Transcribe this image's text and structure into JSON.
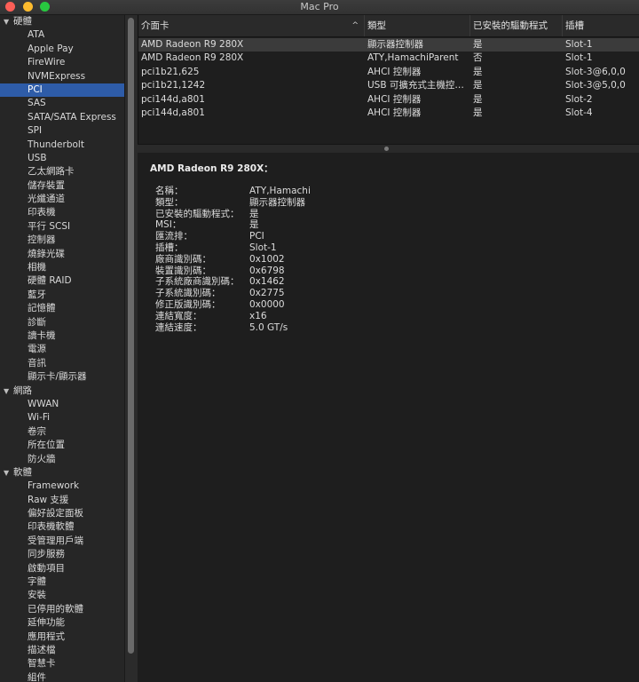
{
  "window": {
    "title": "Mac Pro",
    "traffic_lights": {
      "close": "#fe5f57",
      "minimize": "#febc2e",
      "zoom": "#28c840"
    }
  },
  "sidebar": {
    "groups": [
      {
        "label": "硬體",
        "expanded": true,
        "items": [
          "ATA",
          "Apple Pay",
          "FireWire",
          "NVMExpress",
          "PCI",
          "SAS",
          "SATA/SATA Express",
          "SPI",
          "Thunderbolt",
          "USB",
          "乙太網路卡",
          "儲存裝置",
          "光纖通道",
          "印表機",
          "平行 SCSI",
          "控制器",
          "燒錄光碟",
          "相機",
          "硬體 RAID",
          "藍牙",
          "記憶體",
          "診斷",
          "讀卡機",
          "電源",
          "音訊",
          "顯示卡/顯示器"
        ]
      },
      {
        "label": "網路",
        "expanded": true,
        "items": [
          "WWAN",
          "Wi-Fi",
          "卷宗",
          "所在位置",
          "防火牆"
        ]
      },
      {
        "label": "軟體",
        "expanded": true,
        "items": [
          "Framework",
          "Raw 支援",
          "偏好設定面板",
          "印表機軟體",
          "受管理用戶端",
          "同步服務",
          "啟動項目",
          "字體",
          "安裝",
          "已停用的軟體",
          "延伸功能",
          "應用程式",
          "描述檔",
          "智慧卡",
          "組件"
        ]
      }
    ],
    "selected": "PCI",
    "selection_color": "#2e5ca8"
  },
  "table": {
    "columns": [
      "介面卡",
      "類型",
      "已安裝的驅動程式",
      "插槽"
    ],
    "sort_icon": "chevron-up-icon",
    "rows": [
      {
        "card": "AMD Radeon R9 280X",
        "type": "顯示器控制器",
        "driver": "是",
        "slot": "Slot-1"
      },
      {
        "card": "AMD Radeon R9 280X",
        "type": "ATY,HamachiParent",
        "driver": "否",
        "slot": "Slot-1"
      },
      {
        "card": "pci1b21,625",
        "type": "AHCI 控制器",
        "driver": "是",
        "slot": "Slot-3@6,0,0"
      },
      {
        "card": "pci1b21,1242",
        "type": "USB 可擴充式主機控…",
        "driver": "是",
        "slot": "Slot-3@5,0,0"
      },
      {
        "card": "pci144d,a801",
        "type": "AHCI 控制器",
        "driver": "是",
        "slot": "Slot-2"
      },
      {
        "card": "pci144d,a801",
        "type": "AHCI 控制器",
        "driver": "是",
        "slot": "Slot-4"
      }
    ],
    "selected_row": 0
  },
  "detail": {
    "title": "AMD Radeon R9 280X：",
    "fields": [
      {
        "key": "名稱：",
        "value": "ATY,Hamachi"
      },
      {
        "key": "類型：",
        "value": "顯示器控制器"
      },
      {
        "key": "已安裝的驅動程式：",
        "value": "是"
      },
      {
        "key": "MSI：",
        "value": "是"
      },
      {
        "key": "匯流排：",
        "value": "PCI"
      },
      {
        "key": "插槽：",
        "value": "Slot-1"
      },
      {
        "key": "廠商識別碼：",
        "value": "0x1002"
      },
      {
        "key": "裝置識別碼：",
        "value": "0x6798"
      },
      {
        "key": "子系統廠商識別碼：",
        "value": "0x1462"
      },
      {
        "key": "子系統識別碼：",
        "value": "0x2775"
      },
      {
        "key": "修正版識別碼：",
        "value": "0x0000"
      },
      {
        "key": "連結寬度：",
        "value": "x16"
      },
      {
        "key": "連結速度：",
        "value": "5.0 GT/s"
      }
    ]
  }
}
